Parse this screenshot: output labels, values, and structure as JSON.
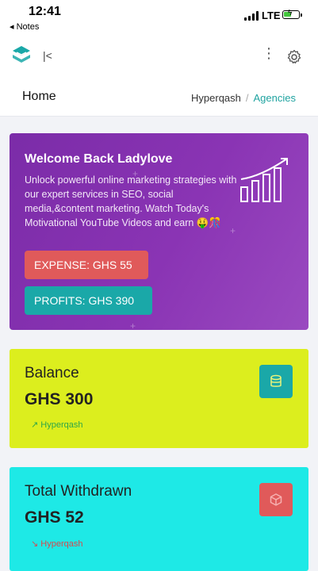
{
  "status_bar": {
    "time": "12:41",
    "back_app": "◂ Notes",
    "network": "LTE"
  },
  "topbar": {
    "logo_icon": "layers-logo-icon",
    "collapse_label": "|<",
    "more_label": "⋮",
    "settings_icon": "gear-icon"
  },
  "header": {
    "title": "Home",
    "breadcrumb": {
      "parent": "Hyperqash",
      "separator": "/",
      "current": "Agencies"
    }
  },
  "welcome": {
    "title": "Welcome Back Ladylove",
    "message": "Unlock powerful online marketing strategies with our expert services in SEO, social media,&content marketing. Watch Today's Motivational YouTube Videos and earn 🤑🎊",
    "expense_label": "EXPENSE: GHS 55",
    "profits_label": "PROFITS: GHS 390",
    "art_icon": "growth-chart-icon"
  },
  "cards": {
    "balance": {
      "label": "Balance",
      "value": "GHS 300",
      "trend_icon": "trend-up-icon",
      "trend_glyph": "↗",
      "trend_text": "Hyperqash",
      "icon": "database-icon"
    },
    "withdrawn": {
      "label": "Total Withdrawn",
      "value": "GHS 52",
      "trend_icon": "trend-down-icon",
      "trend_glyph": "↘",
      "trend_text": "Hyperqash",
      "icon": "box-icon"
    }
  },
  "colors": {
    "accent_teal": "#1aa8a8",
    "accent_red": "#e05a5a",
    "welcome_purple": "#8a34b4",
    "balance_yellow": "#dcee1e",
    "withdrawn_cyan": "#1ee9e6"
  }
}
